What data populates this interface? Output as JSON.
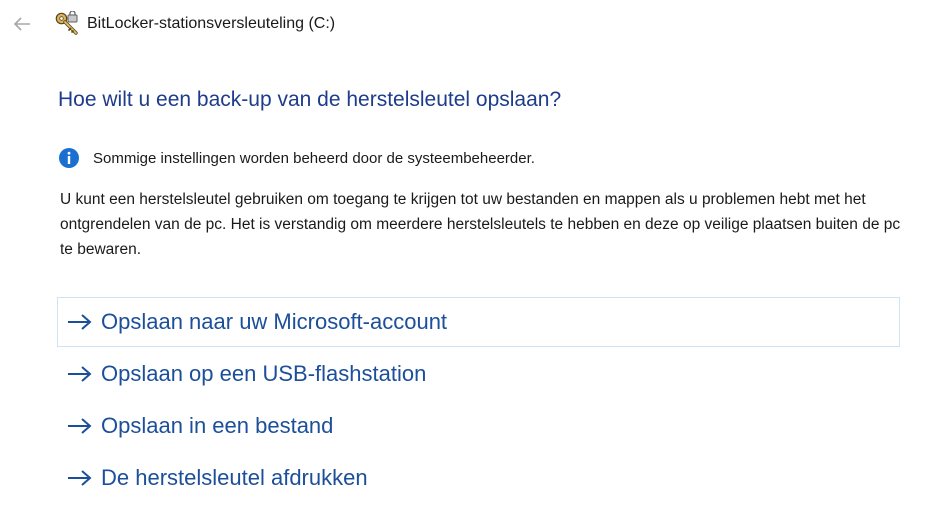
{
  "window": {
    "title": "BitLocker-stationsversleuteling (C:)",
    "back_icon": "arrow-left-icon",
    "app_icon": "bitlocker-key-icon"
  },
  "main": {
    "heading": "Hoe wilt u een back-up van de herstelsleutel opslaan?",
    "info": {
      "icon": "info-icon",
      "text": "Sommige instellingen worden beheerd door de systeembeheerder."
    },
    "description": "U kunt een herstelsleutel gebruiken om toegang te krijgen tot uw bestanden en mappen als u problemen hebt met het ontgrendelen van de pc. Het is verstandig om meerdere herstelsleutels te hebben en deze op veilige plaatsen buiten de pc te bewaren.",
    "options": [
      {
        "label": "Opslaan naar uw Microsoft-account",
        "selected": true
      },
      {
        "label": "Opslaan op een USB-flashstation",
        "selected": false
      },
      {
        "label": "Opslaan in een bestand",
        "selected": false
      },
      {
        "label": "De herstelsleutel afdrukken",
        "selected": false
      }
    ]
  },
  "colors": {
    "heading": "#1e3c8c",
    "link": "#1c4f9a",
    "info_blue": "#1a6fd1",
    "selected_border": "#cde4f4"
  }
}
